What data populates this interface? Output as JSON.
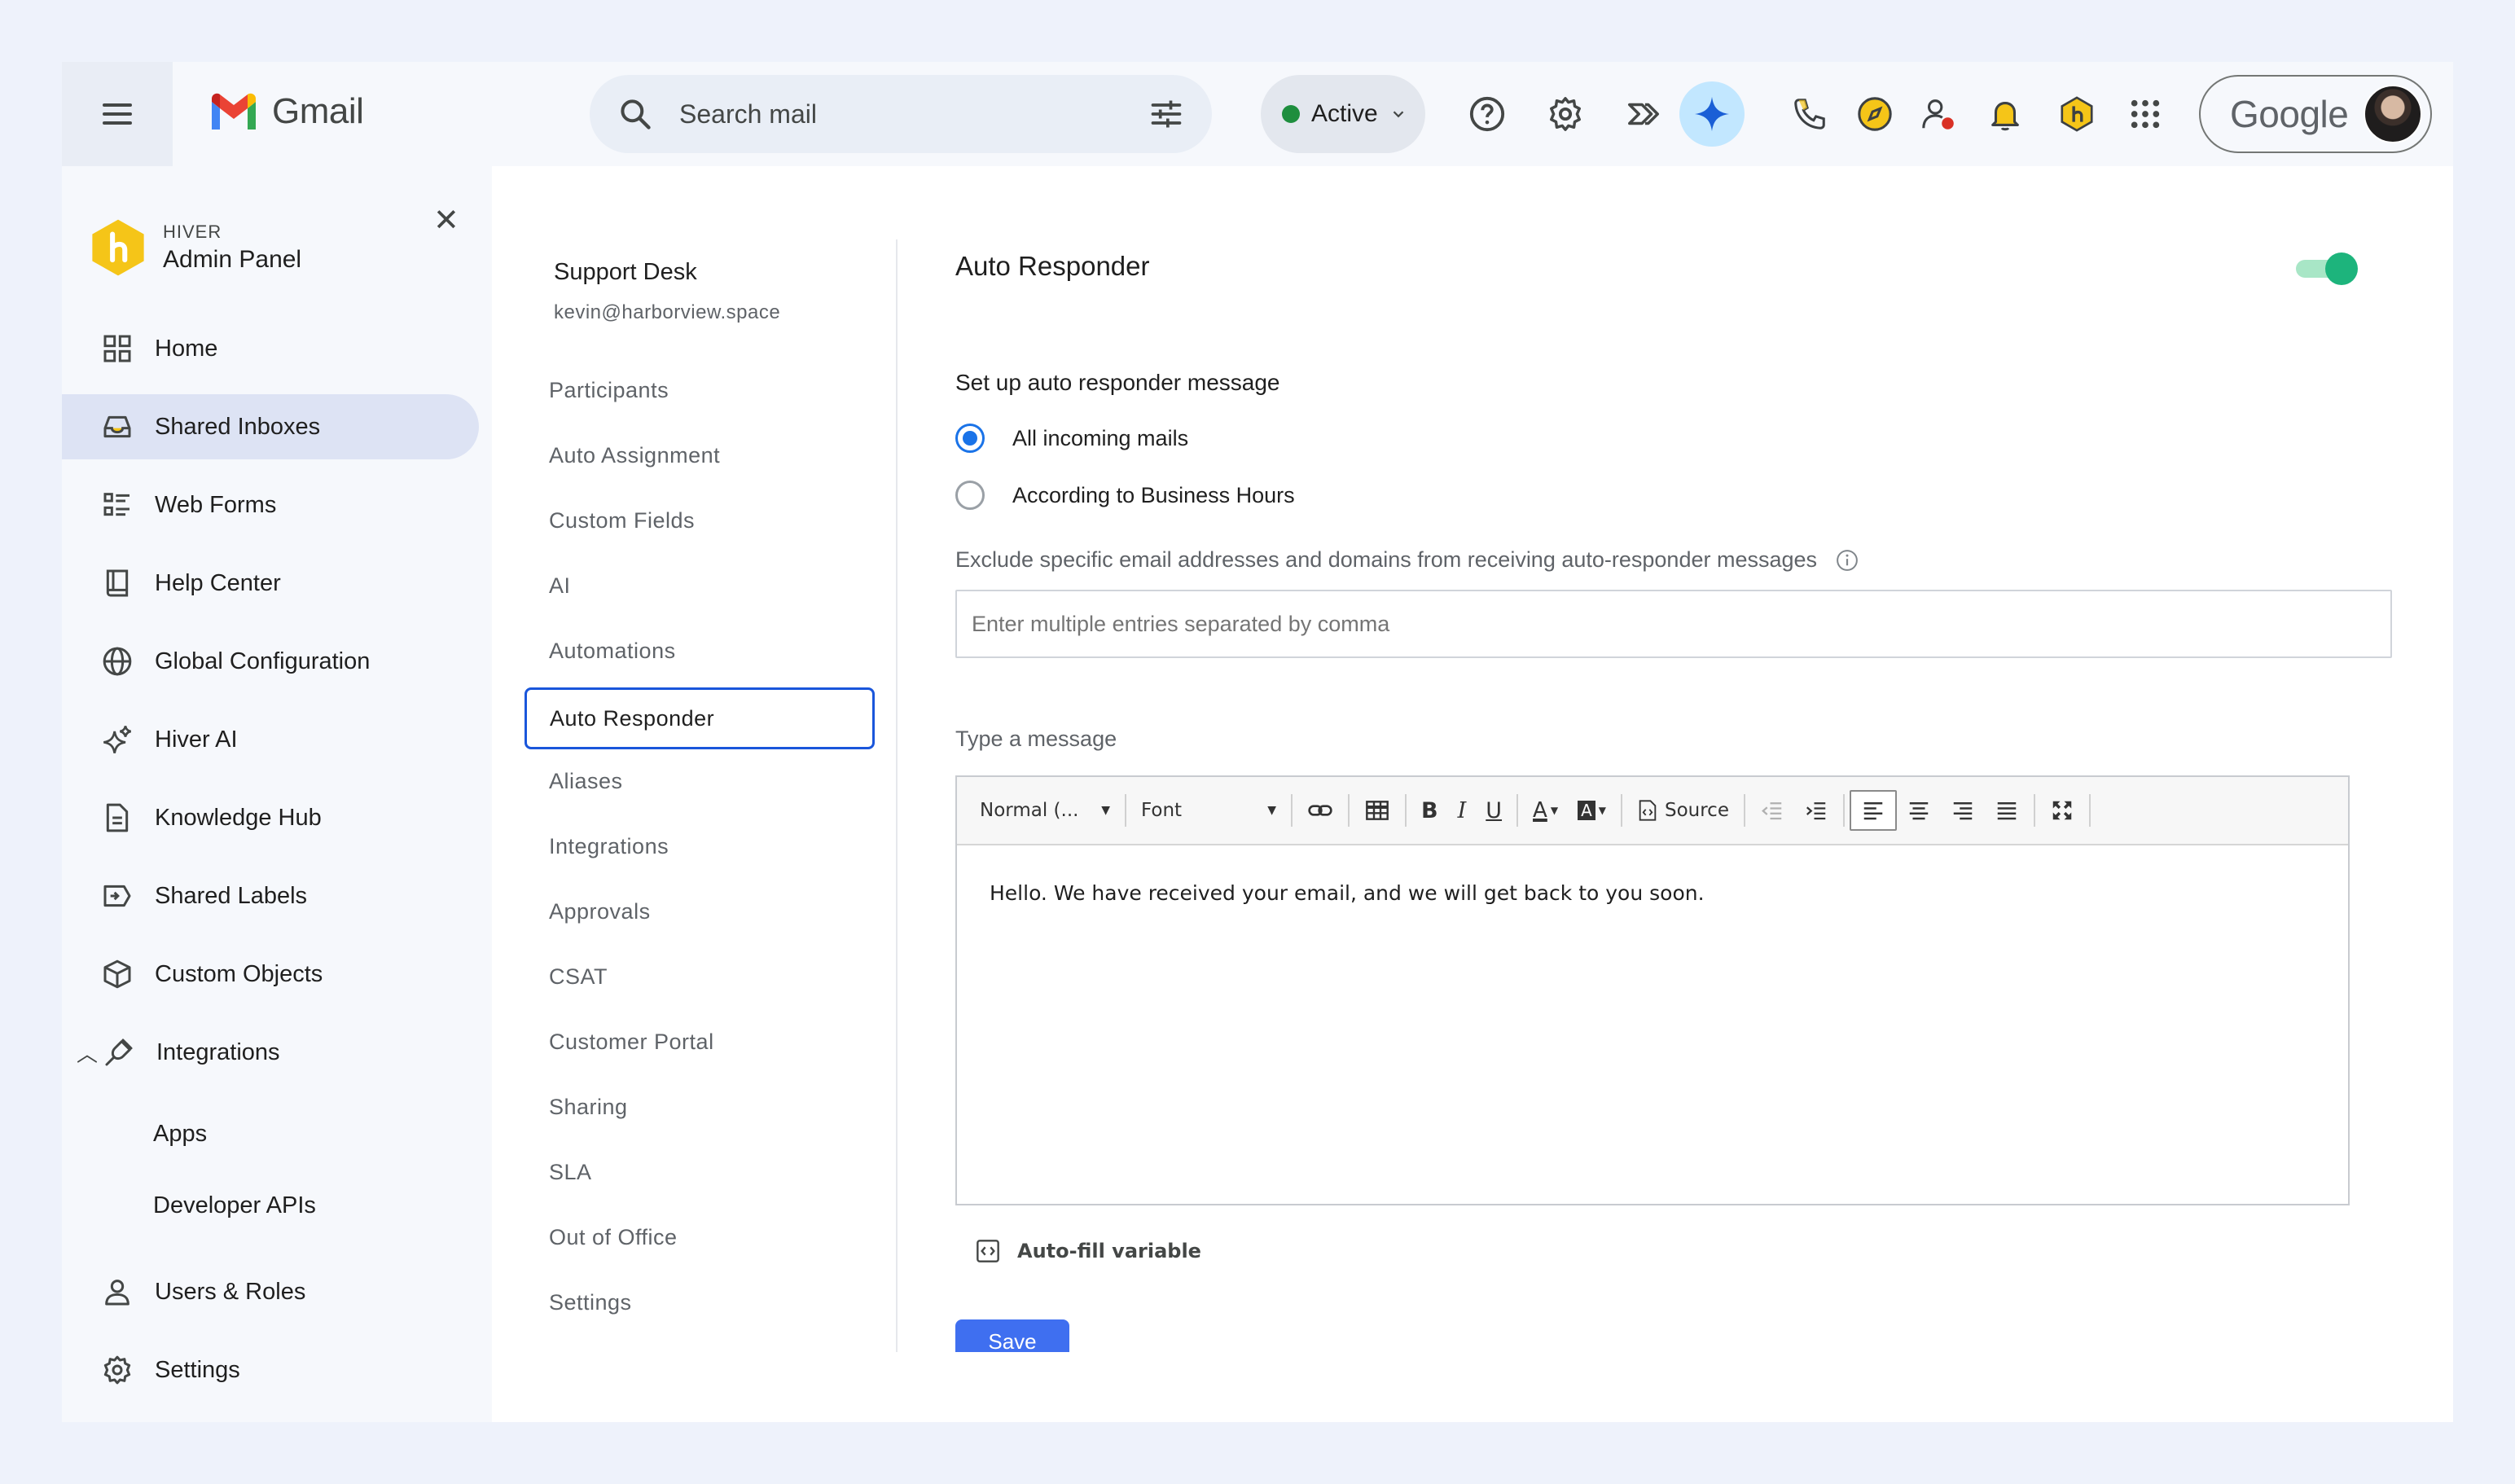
{
  "app": {
    "name": "Gmail",
    "search_placeholder": "Search mail",
    "status": "Active",
    "google_label": "Google"
  },
  "colors": {
    "accent": "#1a73e8",
    "active_status": "#1e8e3e",
    "toggle_on": "#1db47c",
    "selected_nav": "#dde3f4",
    "save_button": "#3f6ff0"
  },
  "sidebar": {
    "brand_small": "HIVER",
    "brand_title": "Admin Panel",
    "items": [
      {
        "label": "Home",
        "icon": "grid-icon"
      },
      {
        "label": "Shared Inboxes",
        "icon": "inbox-icon",
        "active": true
      },
      {
        "label": "Web Forms",
        "icon": "form-icon"
      },
      {
        "label": "Help Center",
        "icon": "book-icon"
      },
      {
        "label": "Global Configuration",
        "icon": "globe-icon"
      },
      {
        "label": "Hiver AI",
        "icon": "sparkle-icon"
      },
      {
        "label": "Knowledge Hub",
        "icon": "document-icon"
      },
      {
        "label": "Shared Labels",
        "icon": "label-icon"
      },
      {
        "label": "Custom Objects",
        "icon": "cube-icon"
      },
      {
        "label": "Integrations",
        "icon": "plug-icon",
        "expanded": true
      },
      {
        "label": "Users & Roles",
        "icon": "person-icon"
      },
      {
        "label": "Settings",
        "icon": "gear-icon"
      }
    ],
    "sub_items": [
      "Apps",
      "Developer APIs"
    ]
  },
  "inbox": {
    "name": "Support Desk",
    "email": "kevin@harborview.space",
    "menu": [
      "Participants",
      "Auto Assignment",
      "Custom Fields",
      "AI",
      "Automations",
      "Auto Responder",
      "Aliases",
      "Integrations",
      "Approvals",
      "CSAT",
      "Customer Portal",
      "Sharing",
      "SLA",
      "Out of Office",
      "Settings"
    ],
    "active_menu": "Auto Responder"
  },
  "auto_responder": {
    "title": "Auto Responder",
    "enabled": true,
    "setup_label": "Set up auto responder message",
    "options": [
      "All incoming mails",
      "According to Business Hours"
    ],
    "selected_option": "All incoming mails",
    "exclude_label": "Exclude specific email addresses and domains from receiving auto-responder messages",
    "exclude_placeholder": "Enter multiple entries separated by comma",
    "message_label": "Type a message",
    "editor": {
      "format_label": "Normal (...",
      "font_label": "Font",
      "source_label": "Source",
      "body": "Hello. We have received your email, and we will get back to you soon."
    },
    "autofill_label": "Auto-fill variable",
    "save_label": "Save"
  }
}
